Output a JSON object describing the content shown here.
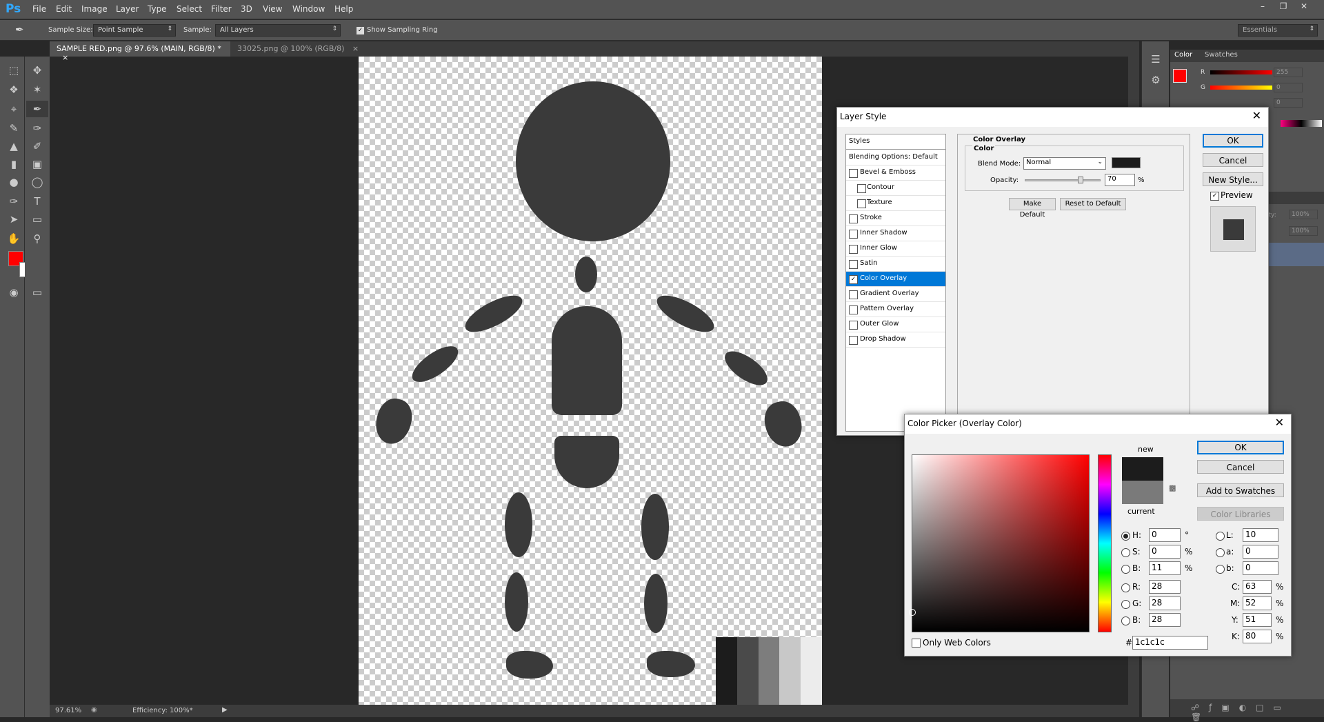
{
  "app": {
    "logo": "Ps",
    "menu": [
      "File",
      "Edit",
      "Image",
      "Layer",
      "Type",
      "Select",
      "Filter",
      "3D",
      "View",
      "Window",
      "Help"
    ]
  },
  "options": {
    "sample_size_label": "Sample Size:",
    "sample_size_value": "Point Sample",
    "sample_label": "Sample:",
    "sample_value": "All Layers",
    "show_ring_label": "Show Sampling Ring",
    "workspace": "Essentials"
  },
  "tabs": [
    {
      "label": "SAMPLE RED.png @ 97.6% (MAIN, RGB/8) *"
    },
    {
      "label": "33025.png @ 100% (RGB/8)"
    }
  ],
  "status": {
    "zoom": "97.61%",
    "efficiency": "Efficiency: 100%*"
  },
  "colors": {
    "foreground": "#ff0000",
    "background": "#ffffff",
    "overlay": "#1c1c1c",
    "figure": "#3a3a3a",
    "accent": "#0078d7"
  },
  "right_panel": {
    "tabs": [
      "Color",
      "Swatches"
    ],
    "r_label": "R",
    "g_label": "G",
    "r_value": "255",
    "g_value": "0",
    "b_value": "0",
    "opacity1": "100%",
    "opacity2": "100%",
    "opacity_label": "ity:"
  },
  "layer_style": {
    "title": "Layer Style",
    "styles_header": "Styles",
    "blending": "Blending Options: Default",
    "items": [
      {
        "label": "Bevel & Emboss",
        "checked": false,
        "indent": false
      },
      {
        "label": "Contour",
        "checked": false,
        "indent": true
      },
      {
        "label": "Texture",
        "checked": false,
        "indent": true
      },
      {
        "label": "Stroke",
        "checked": false,
        "indent": false
      },
      {
        "label": "Inner Shadow",
        "checked": false,
        "indent": false
      },
      {
        "label": "Inner Glow",
        "checked": false,
        "indent": false
      },
      {
        "label": "Satin",
        "checked": false,
        "indent": false
      },
      {
        "label": "Color Overlay",
        "checked": true,
        "indent": false,
        "selected": true
      },
      {
        "label": "Gradient Overlay",
        "checked": false,
        "indent": false
      },
      {
        "label": "Pattern Overlay",
        "checked": false,
        "indent": false
      },
      {
        "label": "Outer Glow",
        "checked": false,
        "indent": false
      },
      {
        "label": "Drop Shadow",
        "checked": false,
        "indent": false
      }
    ],
    "section_title": "Color Overlay",
    "group_title": "Color",
    "blend_mode_label": "Blend Mode:",
    "blend_mode_value": "Normal",
    "opacity_label": "Opacity:",
    "opacity_value": "70",
    "opacity_unit": "%",
    "opacity_level": 0.7,
    "make_default": "Make Default",
    "reset_default": "Reset to Default",
    "ok": "OK",
    "cancel": "Cancel",
    "new_style": "New Style...",
    "preview_label": "Preview"
  },
  "color_picker": {
    "title": "Color Picker (Overlay Color)",
    "new_label": "new",
    "current_label": "current",
    "ok": "OK",
    "cancel": "Cancel",
    "add_swatches": "Add to Swatches",
    "color_libraries": "Color Libraries",
    "only_web": "Only Web Colors",
    "hsb": [
      {
        "label": "H:",
        "value": "0",
        "unit": "°",
        "on": true
      },
      {
        "label": "S:",
        "value": "0",
        "unit": "%",
        "on": false
      },
      {
        "label": "B:",
        "value": "11",
        "unit": "%",
        "on": false
      }
    ],
    "rgb": [
      {
        "label": "R:",
        "value": "28"
      },
      {
        "label": "G:",
        "value": "28"
      },
      {
        "label": "B:",
        "value": "28"
      }
    ],
    "lab": [
      {
        "label": "L:",
        "value": "10"
      },
      {
        "label": "a:",
        "value": "0"
      },
      {
        "label": "b:",
        "value": "0"
      }
    ],
    "cmyk": [
      {
        "label": "C:",
        "value": "63",
        "unit": "%"
      },
      {
        "label": "M:",
        "value": "52",
        "unit": "%"
      },
      {
        "label": "Y:",
        "value": "51",
        "unit": "%"
      },
      {
        "label": "K:",
        "value": "80",
        "unit": "%"
      }
    ],
    "hex_label": "#",
    "hex_value": "1c1c1c",
    "new_color": "#1c1c1c",
    "current_color": "#7a7a7a"
  },
  "swatch_strip": [
    "#1c1c1c",
    "#4a4a4a",
    "#7d7d7d",
    "#c8c8c8",
    "#ececec"
  ]
}
